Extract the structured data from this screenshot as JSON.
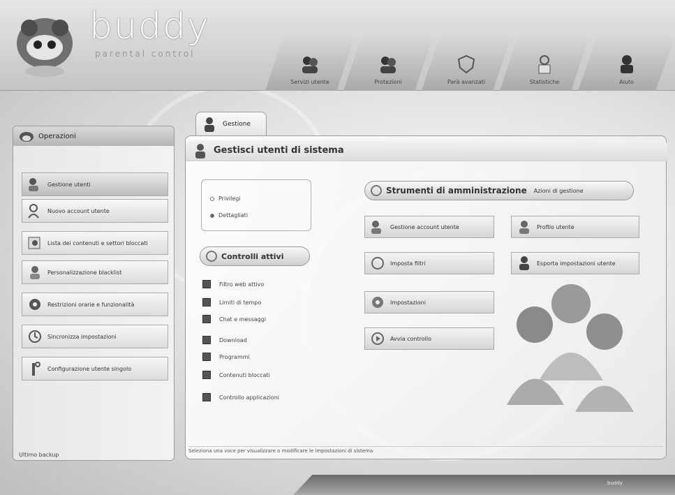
{
  "header": {
    "logo": "buddy",
    "logo_sub": "parental control",
    "tabs": [
      {
        "label": "Servizi utente",
        "icon": "users-icon"
      },
      {
        "label": "Protezioni",
        "icon": "users-lock-icon"
      },
      {
        "label": "Parà avanzati",
        "icon": "shield-icon"
      },
      {
        "label": "Statistiche",
        "icon": "report-icon"
      },
      {
        "label": "Aiuto",
        "icon": "help-icon"
      }
    ]
  },
  "sidebar": {
    "title": "Operazioni",
    "items": [
      {
        "label": "Gestione utenti",
        "icon": "users-icon",
        "active": true
      },
      {
        "label": "Nuovo account utente",
        "icon": "add-user-icon"
      },
      {
        "label": "Lista dei contenuti e settori bloccati",
        "icon": "lock-list-icon"
      },
      {
        "label": "Personalizzazione blacklist",
        "icon": "person-icon"
      },
      {
        "label": "Restrizioni orarie e funzionalità",
        "icon": "gear-icon"
      },
      {
        "label": "Sincronizza impostazioni",
        "icon": "sync-icon"
      },
      {
        "label": "Configurazione utente singolo",
        "icon": "key-icon"
      }
    ],
    "footer": "Ultimo backup"
  },
  "main": {
    "tab": "Gestione",
    "title": "Gestisci utenti di sistema",
    "radio_group": {
      "options": [
        "Privilegi",
        "Dettagliati"
      ]
    },
    "controls_title": "Controlli attivi",
    "checks": [
      "Filtro web attivo",
      "Limiti di tempo",
      "Chat e messaggi",
      "Download",
      "Programmi",
      "Contenuti bloccati",
      "Controllo applicazioni"
    ],
    "actions_title": "Strumenti di amministrazione",
    "actions_sub": "Azioni di gestione",
    "buttons": [
      {
        "label": "Gestione account utente",
        "icon": "users-icon"
      },
      {
        "label": "Profilo utente",
        "icon": "user-icon"
      },
      {
        "label": "Imposta filtri",
        "icon": "filter-icon"
      },
      {
        "label": "Esporta impostazioni utente",
        "icon": "export-icon"
      },
      {
        "label": "Impostazioni",
        "icon": "settings-icon"
      },
      {
        "label": "Avvia controllo",
        "icon": "start-icon"
      }
    ],
    "status": "Seleziona una voce per visualizzare o modificare le impostazioni di sistema"
  },
  "footer": {
    "corner": "buddy"
  }
}
